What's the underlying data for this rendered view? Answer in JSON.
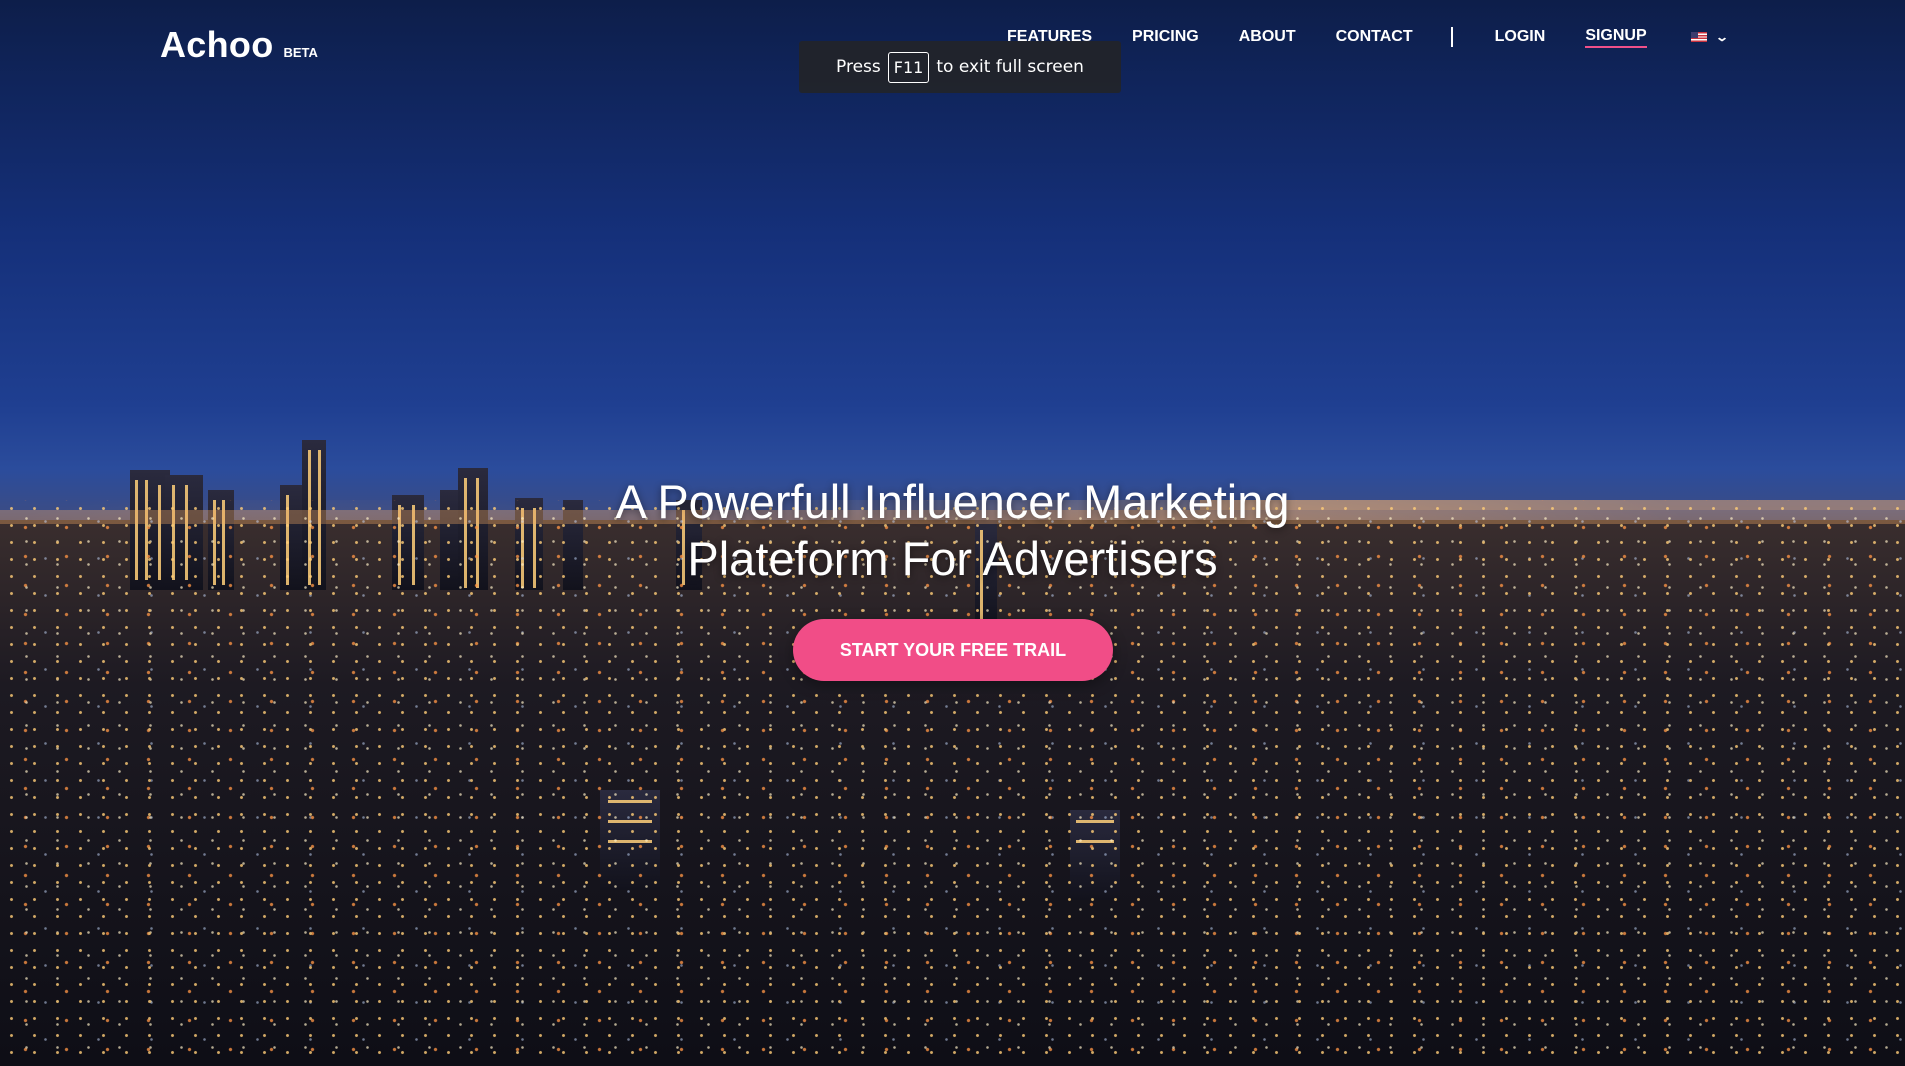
{
  "brand": {
    "name": "Achoo",
    "tag": "BETA"
  },
  "nav": {
    "features": "FEATURES",
    "pricing": "PRICING",
    "about": "ABOUT",
    "contact": "CONTACT",
    "login": "LOGIN",
    "signup": "SIGNUP",
    "language_flag": "us-flag-icon"
  },
  "fullscreen_toast": {
    "prefix": "Press",
    "key": "F11",
    "suffix": "to exit full screen"
  },
  "hero": {
    "title_line1": "A Powerfull Influencer Marketing",
    "title_line2": "Plateform For Advertisers",
    "cta_label": "START YOUR FREE TRAIL"
  },
  "colors": {
    "accent": "#f14d87",
    "sky": "#15307a",
    "text": "#ffffff"
  }
}
